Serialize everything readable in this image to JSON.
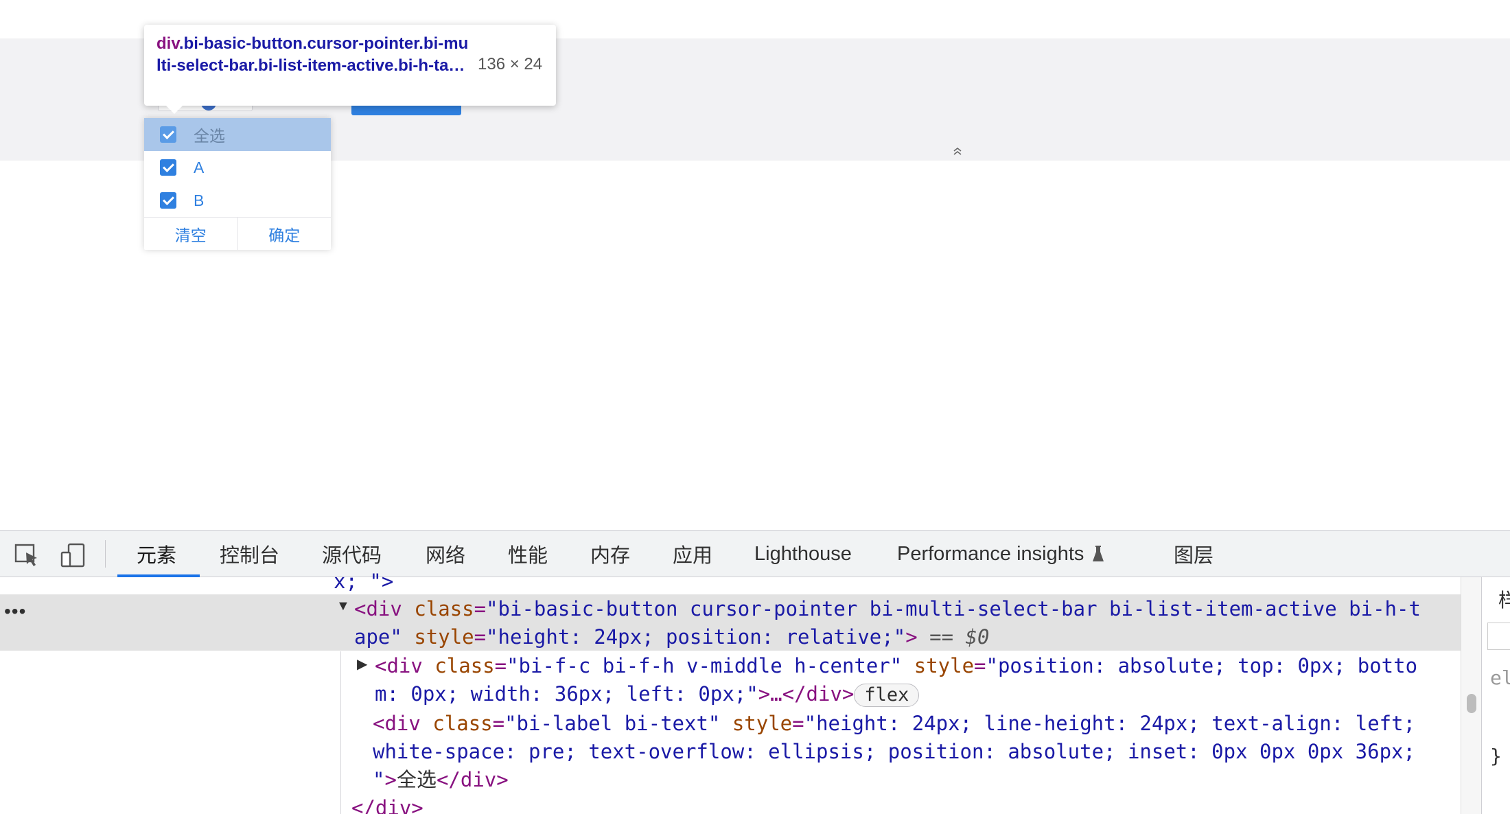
{
  "inspect_tooltip": {
    "tag": "div",
    "selector_rest": ".bi-basic-button.cursor-pointer.bi-multi-select-bar.bi-list-item-active.bi-h-ta…",
    "size": "136 × 24"
  },
  "dropdown": {
    "items": [
      {
        "label": "全选",
        "checked": true,
        "active": true
      },
      {
        "label": "A",
        "checked": true,
        "active": false
      },
      {
        "label": "B",
        "checked": true,
        "active": false
      }
    ],
    "clear_label": "清空",
    "confirm_label": "确定"
  },
  "devtools": {
    "tabs": [
      "元素",
      "控制台",
      "源代码",
      "网络",
      "性能",
      "内存",
      "应用",
      "Lighthouse",
      "Performance insights",
      "图层"
    ],
    "selected_tab": "元素",
    "dom": {
      "line0": "x; \">",
      "line1_tag_open": "<div ",
      "line1_attr1": "class",
      "line1_val1": "\"bi-basic-button cursor-pointer bi-multi-select-bar bi-list-item-active bi-h-t",
      "line2_val1_cont": "ape\"",
      "line2_attr2": "style",
      "line2_val2": "\"height: 24px; position: relative;\"",
      "line2_close": ">",
      "line2_marker": "== $0",
      "line3_tag_open": "<div ",
      "line3_attr1": "class",
      "line3_val1": "\"bi-f-c bi-f-h v-middle h-center\"",
      "line3_attr2": "style",
      "line3_val2": "\"position: absolute; top: 0px; botto",
      "line4_val2_cont": "m: 0px; width: 36px; left: 0px;\"",
      "line4_close": ">…</div>",
      "line4_badge": "flex",
      "line5_tag_open": "<div ",
      "line5_attr1": "class",
      "line5_val1": "\"bi-label bi-text\"",
      "line5_attr2": "style",
      "line5_val2": "\"height: 24px; line-height: 24px; text-align: left;",
      "line6_val2_cont": "white-space: pre; text-overflow: ellipsis; position: absolute; inset: 0px 0px 0px 36px;",
      "line7_val2_end": "\"",
      "line7_close_open": ">",
      "line7_text": "全选",
      "line7_close_tag": "</div>",
      "line8_close": "</div>"
    },
    "styles_fragments": {
      "top": "样",
      "el": "el",
      "brace": "}"
    }
  }
}
